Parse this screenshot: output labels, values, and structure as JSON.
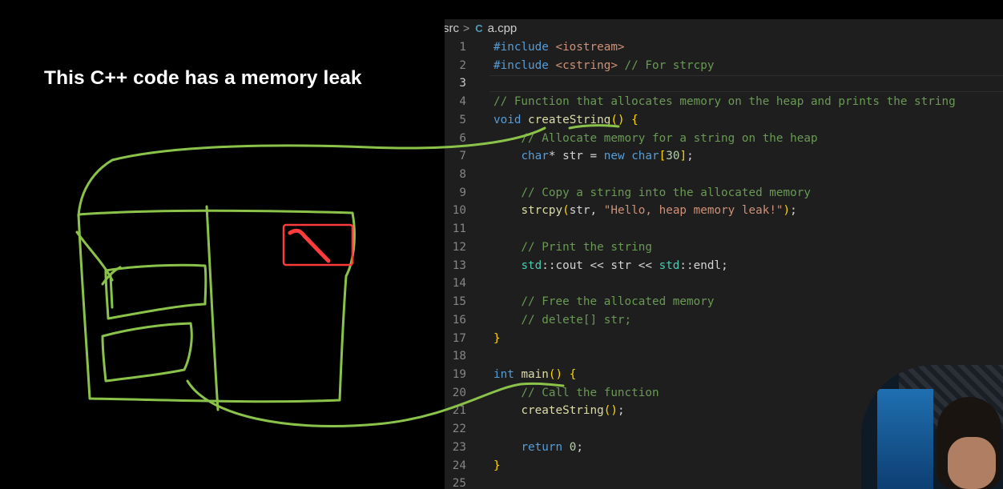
{
  "slide": {
    "title": "This C++ code has a memory leak"
  },
  "breadcrumb": {
    "folder": "src",
    "separator": ">",
    "file_icon": "C",
    "file": "a.cpp"
  },
  "editor": {
    "active_line": 3,
    "lines": [
      {
        "n": "1",
        "tokens": [
          {
            "t": "#include ",
            "c": "kw"
          },
          {
            "t": "<iostream>",
            "c": "str"
          }
        ]
      },
      {
        "n": "2",
        "tokens": [
          {
            "t": "#include ",
            "c": "kw"
          },
          {
            "t": "<cstring>",
            "c": "str"
          },
          {
            "t": " // For strcpy",
            "c": "cm"
          }
        ]
      },
      {
        "n": "3",
        "tokens": []
      },
      {
        "n": "4",
        "tokens": [
          {
            "t": "// Function that allocates memory on the heap and prints the string",
            "c": "cm"
          }
        ]
      },
      {
        "n": "5",
        "tokens": [
          {
            "t": "void ",
            "c": "kw"
          },
          {
            "t": "createString",
            "c": "fn"
          },
          {
            "t": "() ",
            "c": "br"
          },
          {
            "t": "{",
            "c": "br"
          }
        ]
      },
      {
        "n": "6",
        "tokens": [
          {
            "t": "    // Allocate memory for a string on the heap",
            "c": "cm"
          }
        ]
      },
      {
        "n": "7",
        "tokens": [
          {
            "t": "    "
          },
          {
            "t": "char",
            "c": "kw"
          },
          {
            "t": "* str = "
          },
          {
            "t": "new ",
            "c": "kw"
          },
          {
            "t": "char",
            "c": "kw"
          },
          {
            "t": "[",
            "c": "br"
          },
          {
            "t": "30",
            "c": "num"
          },
          {
            "t": "]",
            "c": "br"
          },
          {
            "t": ";"
          }
        ]
      },
      {
        "n": "8",
        "tokens": []
      },
      {
        "n": "9",
        "tokens": [
          {
            "t": "    // Copy a string into the allocated memory",
            "c": "cm"
          }
        ]
      },
      {
        "n": "10",
        "tokens": [
          {
            "t": "    "
          },
          {
            "t": "strcpy",
            "c": "fn"
          },
          {
            "t": "(",
            "c": "br"
          },
          {
            "t": "str, "
          },
          {
            "t": "\"Hello, heap memory leak!\"",
            "c": "str"
          },
          {
            "t": ")",
            "c": "br"
          },
          {
            "t": ";"
          }
        ]
      },
      {
        "n": "11",
        "tokens": []
      },
      {
        "n": "12",
        "tokens": [
          {
            "t": "    // Print the string",
            "c": "cm"
          }
        ]
      },
      {
        "n": "13",
        "tokens": [
          {
            "t": "    "
          },
          {
            "t": "std",
            "c": "ns"
          },
          {
            "t": "::cout << str << "
          },
          {
            "t": "std",
            "c": "ns"
          },
          {
            "t": "::endl;"
          }
        ]
      },
      {
        "n": "14",
        "tokens": []
      },
      {
        "n": "15",
        "tokens": [
          {
            "t": "    // Free the allocated memory",
            "c": "cm"
          }
        ]
      },
      {
        "n": "16",
        "tokens": [
          {
            "t": "    // delete[] str;",
            "c": "cm"
          }
        ]
      },
      {
        "n": "17",
        "tokens": [
          {
            "t": "}",
            "c": "br"
          }
        ]
      },
      {
        "n": "18",
        "tokens": []
      },
      {
        "n": "19",
        "tokens": [
          {
            "t": "int ",
            "c": "kw"
          },
          {
            "t": "main",
            "c": "fn"
          },
          {
            "t": "() ",
            "c": "br"
          },
          {
            "t": "{",
            "c": "br"
          }
        ]
      },
      {
        "n": "20",
        "tokens": [
          {
            "t": "    // Call the function",
            "c": "cm"
          }
        ]
      },
      {
        "n": "21",
        "tokens": [
          {
            "t": "    "
          },
          {
            "t": "createString",
            "c": "fn"
          },
          {
            "t": "()",
            "c": "br"
          },
          {
            "t": ";"
          }
        ]
      },
      {
        "n": "22",
        "tokens": []
      },
      {
        "n": "23",
        "tokens": [
          {
            "t": "    "
          },
          {
            "t": "return ",
            "c": "kw"
          },
          {
            "t": "0",
            "c": "num"
          },
          {
            "t": ";"
          }
        ]
      },
      {
        "n": "24",
        "tokens": [
          {
            "t": "}",
            "c": "br"
          }
        ]
      },
      {
        "n": "25",
        "tokens": []
      }
    ]
  },
  "annotations": {
    "stroke_green": "#8bc34a",
    "stroke_red": "#ff3b3b"
  },
  "webcam": {
    "present": true
  }
}
